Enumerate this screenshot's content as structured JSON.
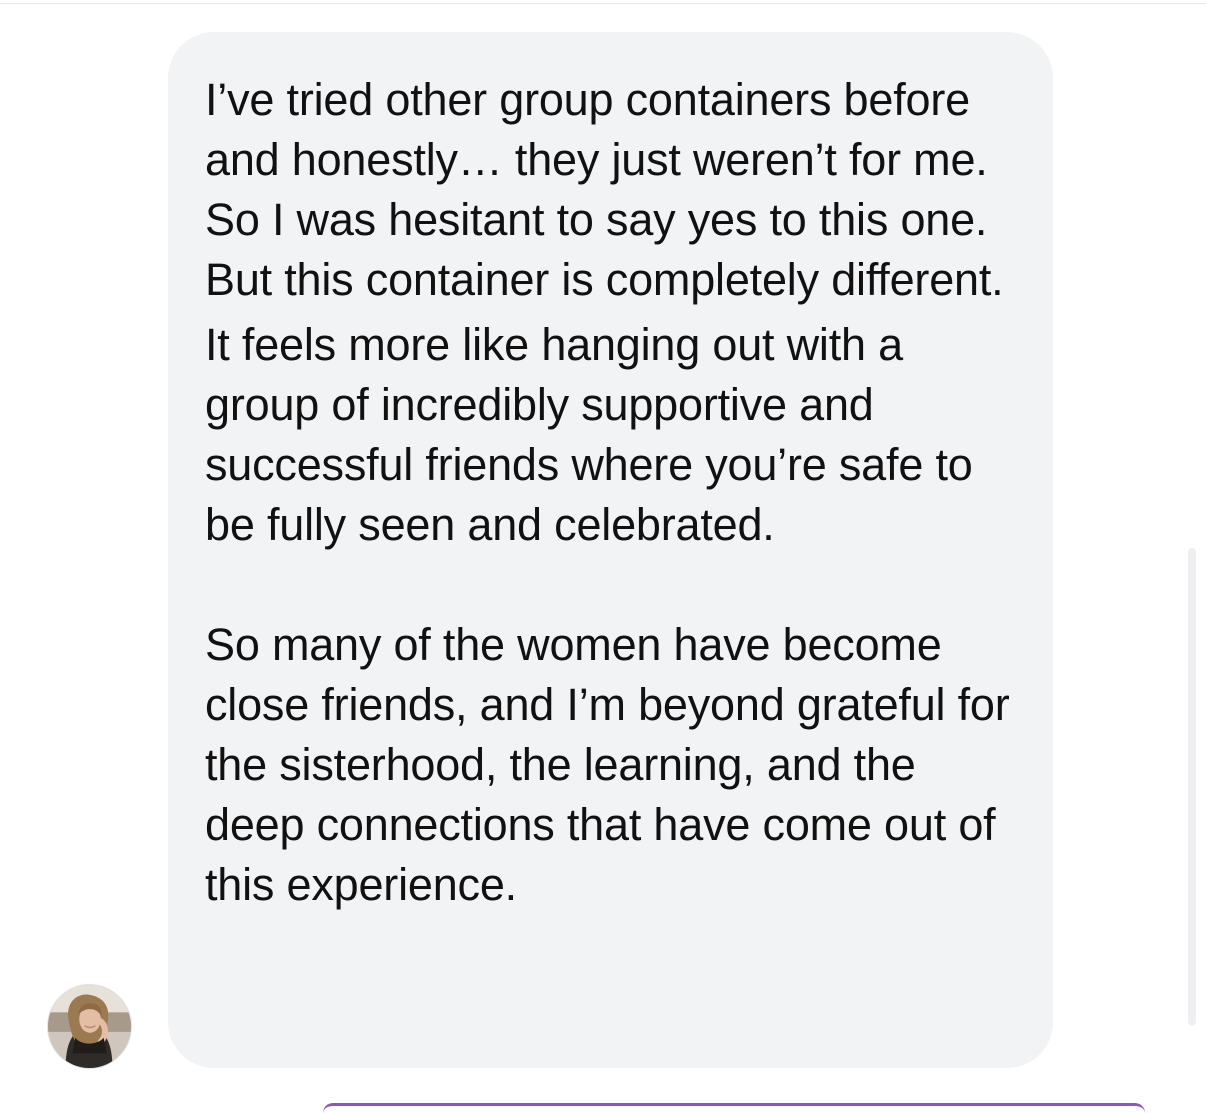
{
  "message": {
    "paragraphs": [
      "I’ve tried other group containers before and honestly… they just weren’t for me. So I was hesitant to say yes to this one. But this container is completely different.",
      "It feels more like hanging out with a group of incredibly supportive and successful friends where you’re safe to be fully seen and celebrated.",
      "So many of the women have become close friends, and I’m beyond grateful for the sisterhood, the learning, and the deep connections that have come out of this experience."
    ]
  },
  "avatar": {
    "icon": "profile-photo"
  },
  "colors": {
    "bubble_background": "#f2f3f5",
    "text": "#111111",
    "accent": "#8e52c9"
  }
}
